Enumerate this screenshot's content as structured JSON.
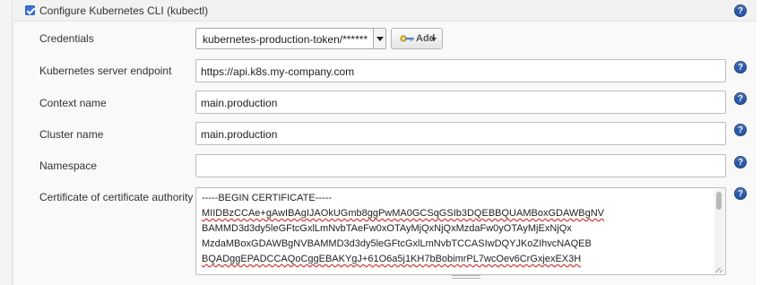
{
  "section": {
    "title": "Configure Kubernetes CLI (kubectl)",
    "checked": true,
    "help_glyph": "?"
  },
  "fields": {
    "credentials": {
      "label": "Credentials",
      "selected": "kubernetes-production-token/******",
      "add_label": "Add"
    },
    "server_endpoint": {
      "label": "Kubernetes server endpoint",
      "value": "https://api.k8s.my-company.com"
    },
    "context_name": {
      "label": "Context name",
      "value": "main.production"
    },
    "cluster_name": {
      "label": "Cluster name",
      "value": "main.production"
    },
    "namespace": {
      "label": "Namespace",
      "value": ""
    },
    "certificate": {
      "label": "Certificate of certificate authority",
      "lines": [
        "-----BEGIN CERTIFICATE-----",
        "MIIDBzCCAe+gAwIBAgIJAOkUGmb8ggPwMA0GCSqGSIb3DQEBBQUAMBoxGDAWBgNV",
        "BAMMD3d3dy5leGFtcGxlLmNvbTAeFw0xOTAyMjQxNjQxMzdaFw0yOTAyMjExNjQx",
        "MzdaMBoxGDAWBgNVBAMMD3d3dy5leGFtcGxlLmNvbTCCASIwDQYJKoZIhvcNAQEB",
        "BQADggEPADCCAQoCggEBAKYgJ+61O6a5j1KH7bBobimrPL7wcOev6CrGxjexEX3H"
      ]
    }
  },
  "icons": {
    "help": "help-icon",
    "key": "key-icon"
  },
  "colors": {
    "checkbox": "#3b73d4",
    "help_icon": "#2b5aa8",
    "spellcheck": "#d12f2f"
  }
}
